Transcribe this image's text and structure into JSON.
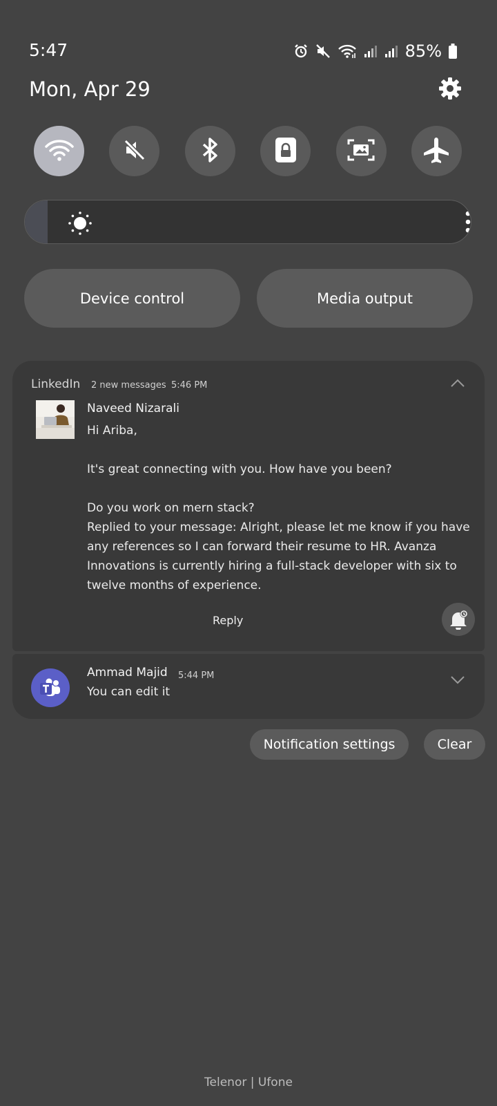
{
  "status_bar": {
    "time": "5:47",
    "battery": "85%",
    "icons": [
      "alarm-icon",
      "mute-icon",
      "wifi-icon",
      "signal-icon",
      "signal-icon",
      "battery-icon"
    ]
  },
  "header": {
    "date": "Mon, Apr 29",
    "settings_icon": "gear-icon"
  },
  "quick_settings": [
    {
      "name": "wifi",
      "icon": "wifi-icon",
      "active": true
    },
    {
      "name": "sound",
      "icon": "mute-icon",
      "active": false
    },
    {
      "name": "bluetooth",
      "icon": "bluetooth-icon",
      "active": false
    },
    {
      "name": "rotation-lock",
      "icon": "lock-rotation-icon",
      "active": false
    },
    {
      "name": "screenshot",
      "icon": "screen-capture-icon",
      "active": false
    },
    {
      "name": "airplane-mode",
      "icon": "airplane-icon",
      "active": false
    }
  ],
  "brightness": {
    "level": 0.05,
    "icon": "sun-icon",
    "more_icon": "more-vertical-icon"
  },
  "panels": {
    "device_control": "Device control",
    "media_output": "Media output"
  },
  "notifications": [
    {
      "app": "LinkedIn",
      "summary": "2 new messages",
      "time": "5:46 PM",
      "sender": "Naveed Nizarali",
      "lines": [
        "Hi Ariba,",
        "",
        "It's great connecting with you. How have you been?",
        "",
        "Do you work on mern stack?",
        "Replied to your message: Alright, please let me know if you have any references so I can forward their resume to HR.  Avanza Innovations is currently hiring a full-stack developer with six to twelve months of experience."
      ],
      "action": "Reply",
      "expand_icon": "chevron-up-icon",
      "snooze_icon": "snooze-bell-icon"
    },
    {
      "app_icon": "teams-icon",
      "sender": "Ammad Majid",
      "time": "5:44 PM",
      "message": "You can edit it",
      "expand_icon": "chevron-down-icon"
    }
  ],
  "actions": {
    "notification_settings": "Notification settings",
    "clear": "Clear"
  },
  "carrier": "Telenor | Ufone"
}
